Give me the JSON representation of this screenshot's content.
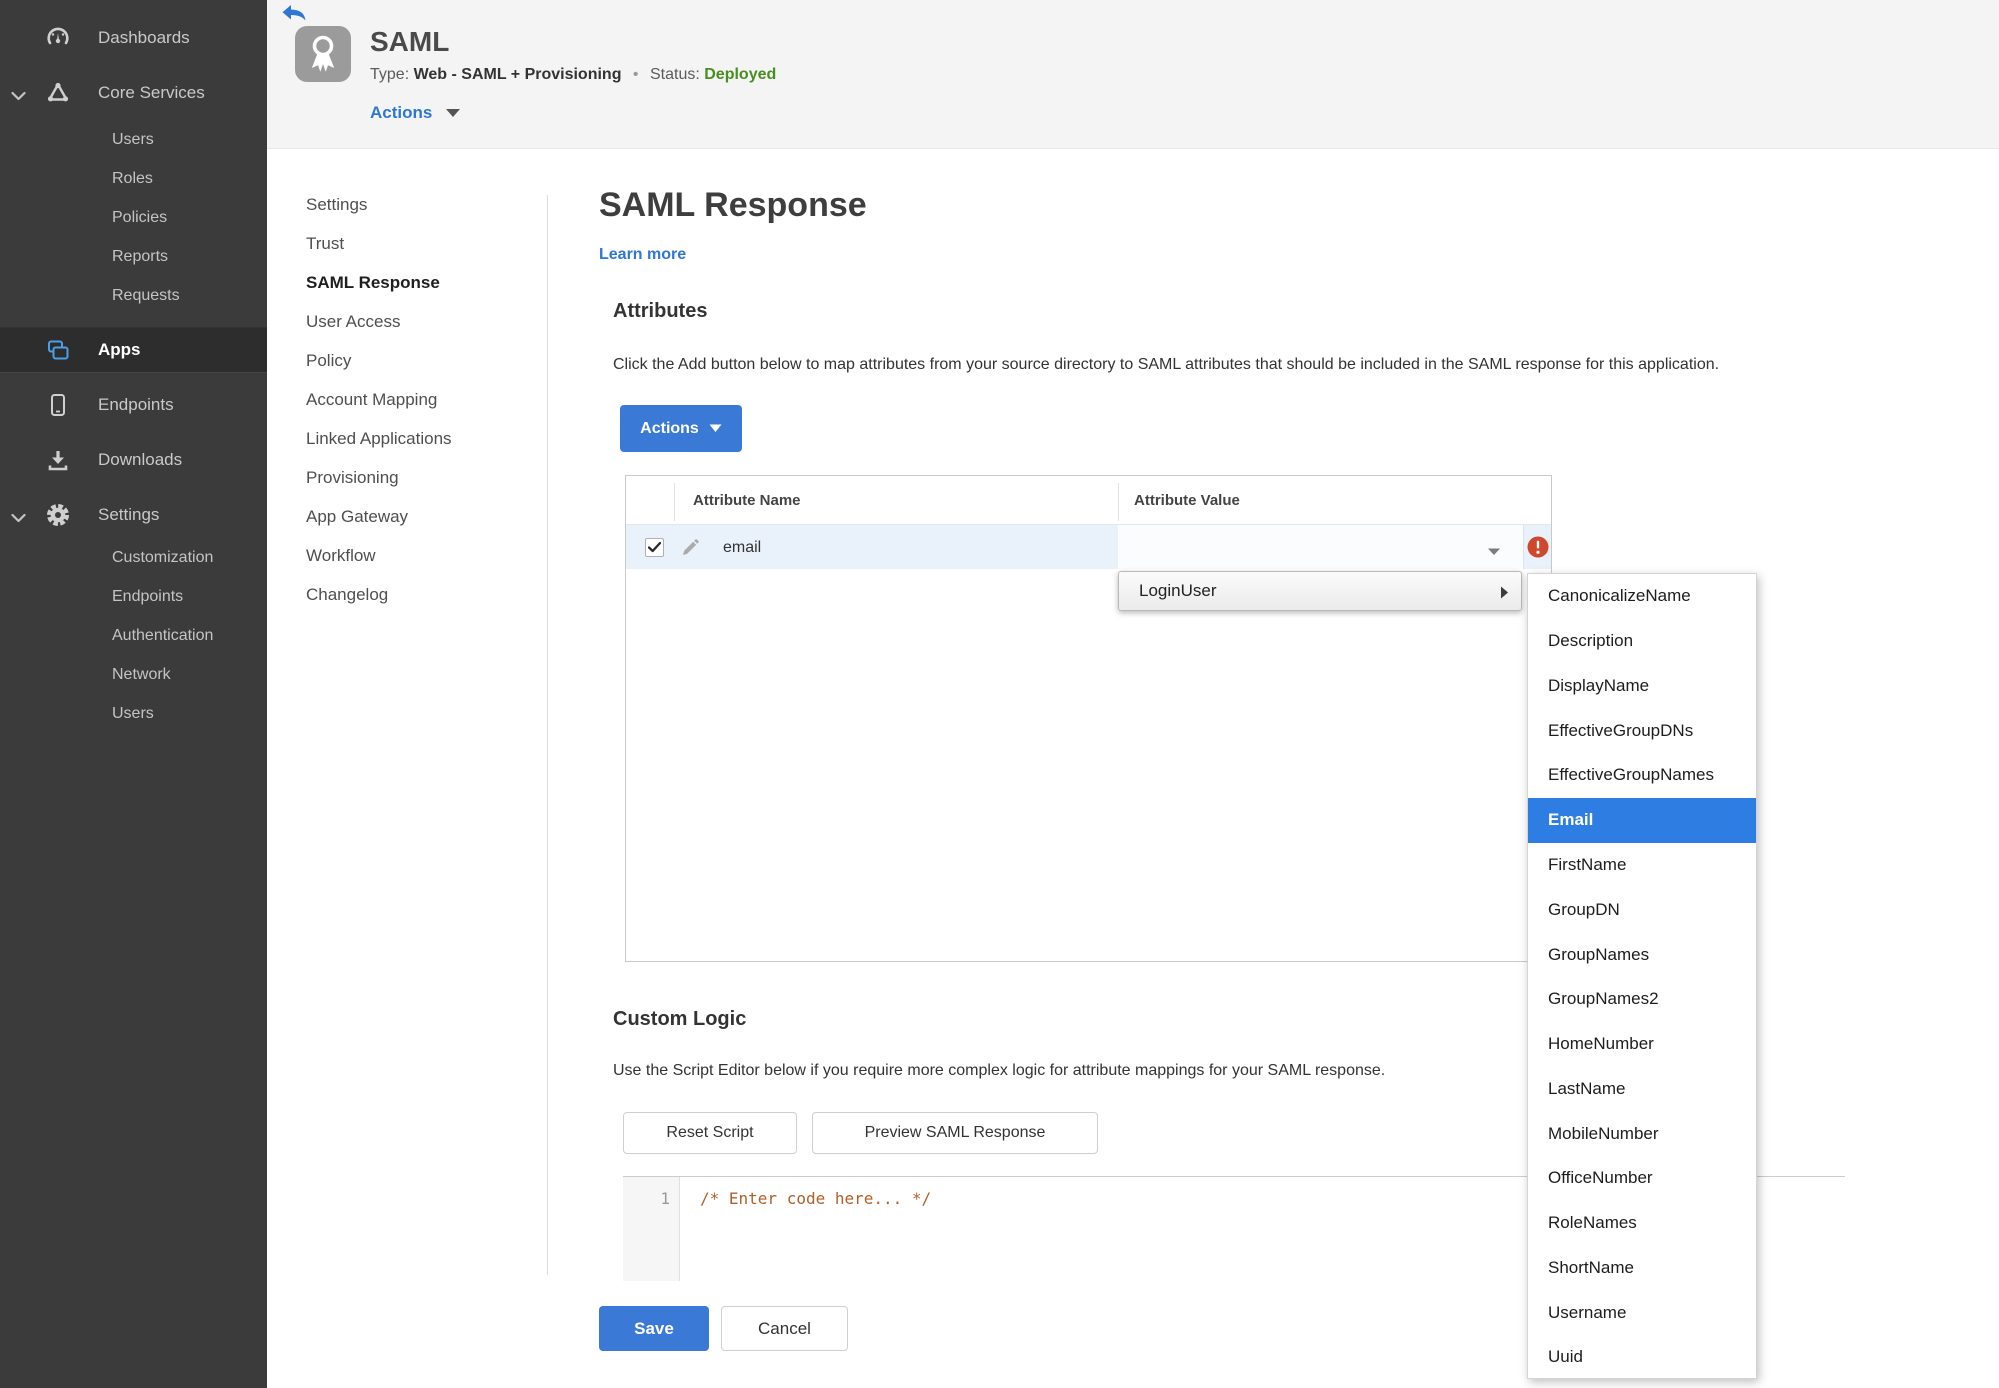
{
  "sidebar": {
    "dashboards": "Dashboards",
    "core_services": "Core Services",
    "core_children": {
      "users": "Users",
      "roles": "Roles",
      "policies": "Policies",
      "reports": "Reports",
      "requests": "Requests"
    },
    "apps": "Apps",
    "endpoints": "Endpoints",
    "downloads": "Downloads",
    "settings": "Settings",
    "settings_children": {
      "customization": "Customization",
      "endpoints": "Endpoints",
      "authentication": "Authentication",
      "network": "Network",
      "users": "Users"
    }
  },
  "header": {
    "title": "SAML",
    "type_label": "Type:",
    "type_value": "Web - SAML + Provisioning",
    "separator": "•",
    "status_label": "Status:",
    "status_value": "Deployed",
    "actions_label": "Actions"
  },
  "subnav": {
    "items": [
      "Settings",
      "Trust",
      "SAML Response",
      "User Access",
      "Policy",
      "Account Mapping",
      "Linked Applications",
      "Provisioning",
      "App Gateway",
      "Workflow",
      "Changelog"
    ],
    "active": "SAML Response"
  },
  "content": {
    "title": "SAML Response",
    "learn_more": "Learn more",
    "attributes": {
      "heading": "Attributes",
      "description": "Click the Add button below to map attributes from your source directory to SAML attributes that should be included in the SAML response for this application.",
      "actions_button": "Actions",
      "table": {
        "columns": [
          "Attribute Name",
          "Attribute Value"
        ],
        "rows": [
          {
            "name": "email",
            "checked": true,
            "value": ""
          }
        ]
      }
    },
    "value_menu": {
      "root_item": "LoginUser",
      "selected": "Email",
      "items": [
        "CanonicalizeName",
        "Description",
        "DisplayName",
        "EffectiveGroupDNs",
        "EffectiveGroupNames",
        "Email",
        "FirstName",
        "GroupDN",
        "GroupNames",
        "GroupNames2",
        "HomeNumber",
        "LastName",
        "MobileNumber",
        "OfficeNumber",
        "RoleNames",
        "ShortName",
        "Username",
        "Uuid"
      ]
    },
    "custom_logic": {
      "heading": "Custom Logic",
      "description": "Use the Script Editor below if you require more complex logic for attribute mappings for your SAML response.",
      "reset_button": "Reset Script",
      "preview_button": "Preview SAML Response",
      "editor": {
        "line_number": "1",
        "code": "/* Enter code here... */"
      }
    },
    "save_button": "Save",
    "cancel_button": "Cancel"
  },
  "colors": {
    "accent_blue": "#3a79d6",
    "selection_blue": "#2e7de2",
    "link_blue": "#2e77d4",
    "status_green": "#47901f",
    "error_red": "#d0472f",
    "sidebar_bg": "#3b3b3b",
    "code_comment": "#b2602a"
  }
}
